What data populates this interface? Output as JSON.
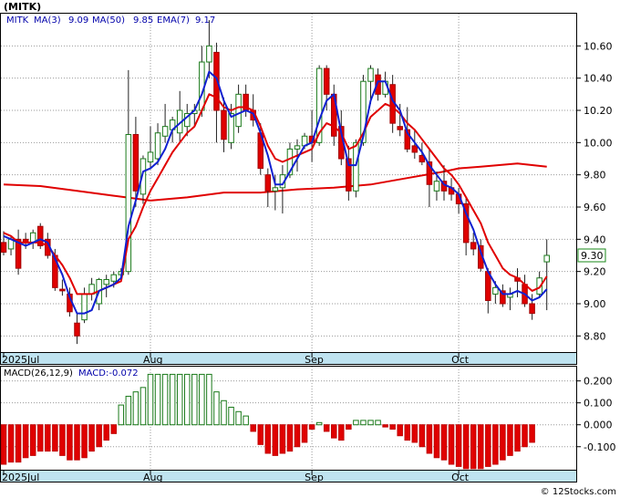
{
  "chart_data": [
    {
      "type": "candlestick",
      "ticker_label": "(MITK)",
      "legend": {
        "symbol": "MITK",
        "ma3_label": "MA(3)",
        "ma3_value": "9.09",
        "ma50_label": "MA(50)",
        "ma50_value": "9.85",
        "ema7_label": "EMA(7)",
        "ema7_value": "9.17"
      },
      "last_price_label": "9.30",
      "last_price": 9.3,
      "ylim": [
        8.7,
        10.8
      ],
      "yticks": [
        {
          "value": 8.8,
          "label": "8.80"
        },
        {
          "value": 9.0,
          "label": "9.00"
        },
        {
          "value": 9.2,
          "label": "9.20"
        },
        {
          "value": 9.4,
          "label": "9.40"
        },
        {
          "value": 9.6,
          "label": "9.60"
        },
        {
          "value": 9.8,
          "label": "9.80"
        },
        {
          "value": 10.0,
          "label": "10.00"
        },
        {
          "value": 10.2,
          "label": "10.20"
        },
        {
          "value": 10.4,
          "label": "10.40"
        },
        {
          "value": 10.6,
          "label": "10.60"
        }
      ],
      "xticks": [
        {
          "index": 0,
          "label": "2025Jul"
        },
        {
          "index": 20,
          "label": "Aug"
        },
        {
          "index": 42,
          "label": "Sep"
        },
        {
          "index": 62,
          "label": "Oct"
        }
      ],
      "candles": [
        [
          9.38,
          9.45,
          9.3,
          9.32
        ],
        [
          9.34,
          9.42,
          9.3,
          9.4
        ],
        [
          9.4,
          9.46,
          9.18,
          9.22
        ],
        [
          9.4,
          9.44,
          9.34,
          9.38
        ],
        [
          9.38,
          9.46,
          9.34,
          9.44
        ],
        [
          9.48,
          9.5,
          9.34,
          9.36
        ],
        [
          9.4,
          9.44,
          9.28,
          9.3
        ],
        [
          9.3,
          9.34,
          9.08,
          9.1
        ],
        [
          9.09,
          9.15,
          9.05,
          9.08
        ],
        [
          9.06,
          9.1,
          8.92,
          8.95
        ],
        [
          8.88,
          8.94,
          8.75,
          8.8
        ],
        [
          8.9,
          9.1,
          8.88,
          9.06
        ],
        [
          9.06,
          9.16,
          9.02,
          9.12
        ],
        [
          9.0,
          9.16,
          8.96,
          9.15
        ],
        [
          9.12,
          9.18,
          9.04,
          9.15
        ],
        [
          9.14,
          9.2,
          9.1,
          9.18
        ],
        [
          9.18,
          9.22,
          9.14,
          9.2
        ],
        [
          9.2,
          10.45,
          9.18,
          10.05
        ],
        [
          10.05,
          10.16,
          9.6,
          9.7
        ],
        [
          9.68,
          9.92,
          9.62,
          9.9
        ],
        [
          9.88,
          10.1,
          9.84,
          9.94
        ],
        [
          9.9,
          10.12,
          9.86,
          10.06
        ],
        [
          10.04,
          10.24,
          10.0,
          10.1
        ],
        [
          10.08,
          10.16,
          10.0,
          10.14
        ],
        [
          10.06,
          10.32,
          10.0,
          10.2
        ],
        [
          10.1,
          10.24,
          10.04,
          10.18
        ],
        [
          10.18,
          10.24,
          10.1,
          10.2
        ],
        [
          10.2,
          10.6,
          10.16,
          10.5
        ],
        [
          10.5,
          10.76,
          10.4,
          10.6
        ],
        [
          10.56,
          10.62,
          10.0,
          10.2
        ],
        [
          10.2,
          10.28,
          9.94,
          10.02
        ],
        [
          10.0,
          10.24,
          9.96,
          10.18
        ],
        [
          10.1,
          10.36,
          10.06,
          10.3
        ],
        [
          10.3,
          10.36,
          10.16,
          10.2
        ],
        [
          10.2,
          10.3,
          10.1,
          10.14
        ],
        [
          10.06,
          10.12,
          9.8,
          9.84
        ],
        [
          9.8,
          9.84,
          9.6,
          9.7
        ],
        [
          9.7,
          9.8,
          9.58,
          9.72
        ],
        [
          9.72,
          9.86,
          9.56,
          9.8
        ],
        [
          9.8,
          10.0,
          9.78,
          9.96
        ],
        [
          9.96,
          10.02,
          9.82,
          9.98
        ],
        [
          9.98,
          10.06,
          9.96,
          10.04
        ],
        [
          10.04,
          10.2,
          9.88,
          10.0
        ],
        [
          10.0,
          10.48,
          9.98,
          10.46
        ],
        [
          10.46,
          10.48,
          10.2,
          10.3
        ],
        [
          10.3,
          10.36,
          9.98,
          10.04
        ],
        [
          10.1,
          10.2,
          9.86,
          9.9
        ],
        [
          9.9,
          9.98,
          9.64,
          9.7
        ],
        [
          9.7,
          10.02,
          9.66,
          10.0
        ],
        [
          10.0,
          10.42,
          9.98,
          10.38
        ],
        [
          10.38,
          10.48,
          10.24,
          10.46
        ],
        [
          10.42,
          10.46,
          10.26,
          10.3
        ],
        [
          10.3,
          10.44,
          10.28,
          10.38
        ],
        [
          10.36,
          10.42,
          10.06,
          10.12
        ],
        [
          10.1,
          10.24,
          10.04,
          10.08
        ],
        [
          10.08,
          10.22,
          9.94,
          9.96
        ],
        [
          9.98,
          10.08,
          9.9,
          9.94
        ],
        [
          9.92,
          10.0,
          9.86,
          9.88
        ],
        [
          9.88,
          9.96,
          9.6,
          9.74
        ],
        [
          9.7,
          9.82,
          9.64,
          9.76
        ],
        [
          9.76,
          9.86,
          9.64,
          9.7
        ],
        [
          9.72,
          9.78,
          9.64,
          9.68
        ],
        [
          9.68,
          9.72,
          9.56,
          9.62
        ],
        [
          9.62,
          9.66,
          9.3,
          9.38
        ],
        [
          9.38,
          9.44,
          9.3,
          9.34
        ],
        [
          9.36,
          9.4,
          9.2,
          9.22
        ],
        [
          9.2,
          9.22,
          8.94,
          9.02
        ],
        [
          9.06,
          9.14,
          9.0,
          9.1
        ],
        [
          9.08,
          9.12,
          8.98,
          9.0
        ],
        [
          9.04,
          9.1,
          8.96,
          9.06
        ],
        [
          9.16,
          9.22,
          9.04,
          9.14
        ],
        [
          9.12,
          9.18,
          8.98,
          9.0
        ],
        [
          9.0,
          9.06,
          8.9,
          8.94
        ],
        [
          9.06,
          9.2,
          9.04,
          9.16
        ],
        [
          9.26,
          9.4,
          8.96,
          9.3
        ]
      ],
      "ma3": [
        [
          0,
          9.42
        ],
        [
          1,
          9.4
        ],
        [
          2,
          9.38
        ],
        [
          3,
          9.36
        ],
        [
          4,
          9.38
        ],
        [
          5,
          9.4
        ],
        [
          6,
          9.38
        ],
        [
          7,
          9.28
        ],
        [
          8,
          9.18
        ],
        [
          9,
          9.04
        ],
        [
          10,
          8.94
        ],
        [
          11,
          8.94
        ],
        [
          12,
          8.96
        ],
        [
          13,
          9.08
        ],
        [
          14,
          9.1
        ],
        [
          15,
          9.12
        ],
        [
          16,
          9.16
        ],
        [
          17,
          9.48
        ],
        [
          18,
          9.64
        ],
        [
          19,
          9.82
        ],
        [
          20,
          9.84
        ],
        [
          21,
          9.88
        ],
        [
          22,
          9.96
        ],
        [
          23,
          10.08
        ],
        [
          24,
          10.12
        ],
        [
          25,
          10.16
        ],
        [
          26,
          10.2
        ],
        [
          27,
          10.3
        ],
        [
          28,
          10.44
        ],
        [
          29,
          10.4
        ],
        [
          30,
          10.26
        ],
        [
          31,
          10.16
        ],
        [
          32,
          10.18
        ],
        [
          33,
          10.2
        ],
        [
          34,
          10.18
        ],
        [
          35,
          10.06
        ],
        [
          36,
          9.92
        ],
        [
          37,
          9.74
        ],
        [
          38,
          9.74
        ],
        [
          39,
          9.82
        ],
        [
          40,
          9.9
        ],
        [
          41,
          9.98
        ],
        [
          42,
          10.0
        ],
        [
          43,
          10.14
        ],
        [
          44,
          10.26
        ],
        [
          45,
          10.3
        ],
        [
          46,
          10.06
        ],
        [
          47,
          9.86
        ],
        [
          48,
          9.86
        ],
        [
          49,
          10.04
        ],
        [
          50,
          10.26
        ],
        [
          51,
          10.38
        ],
        [
          52,
          10.38
        ],
        [
          53,
          10.26
        ],
        [
          54,
          10.2
        ],
        [
          55,
          10.06
        ],
        [
          56,
          10.0
        ],
        [
          57,
          9.94
        ],
        [
          58,
          9.86
        ],
        [
          59,
          9.8
        ],
        [
          60,
          9.74
        ],
        [
          61,
          9.72
        ],
        [
          62,
          9.68
        ],
        [
          63,
          9.56
        ],
        [
          64,
          9.46
        ],
        [
          65,
          9.32
        ],
        [
          66,
          9.2
        ],
        [
          67,
          9.12
        ],
        [
          68,
          9.06
        ],
        [
          69,
          9.06
        ],
        [
          70,
          9.08
        ],
        [
          71,
          9.06
        ],
        [
          72,
          9.02
        ],
        [
          73,
          9.04
        ],
        [
          74,
          9.09
        ]
      ],
      "ema7": [
        [
          0,
          9.44
        ],
        [
          1,
          9.42
        ],
        [
          2,
          9.38
        ],
        [
          3,
          9.38
        ],
        [
          4,
          9.38
        ],
        [
          5,
          9.38
        ],
        [
          6,
          9.36
        ],
        [
          7,
          9.3
        ],
        [
          8,
          9.24
        ],
        [
          9,
          9.16
        ],
        [
          10,
          9.06
        ],
        [
          11,
          9.06
        ],
        [
          12,
          9.06
        ],
        [
          13,
          9.08
        ],
        [
          14,
          9.1
        ],
        [
          15,
          9.12
        ],
        [
          16,
          9.14
        ],
        [
          17,
          9.4
        ],
        [
          18,
          9.48
        ],
        [
          19,
          9.6
        ],
        [
          20,
          9.7
        ],
        [
          21,
          9.78
        ],
        [
          22,
          9.86
        ],
        [
          23,
          9.94
        ],
        [
          24,
          10.0
        ],
        [
          25,
          10.06
        ],
        [
          26,
          10.1
        ],
        [
          27,
          10.2
        ],
        [
          28,
          10.3
        ],
        [
          29,
          10.28
        ],
        [
          30,
          10.22
        ],
        [
          31,
          10.2
        ],
        [
          32,
          10.22
        ],
        [
          33,
          10.22
        ],
        [
          34,
          10.2
        ],
        [
          35,
          10.1
        ],
        [
          36,
          9.98
        ],
        [
          37,
          9.9
        ],
        [
          38,
          9.88
        ],
        [
          39,
          9.9
        ],
        [
          40,
          9.92
        ],
        [
          41,
          9.94
        ],
        [
          42,
          9.96
        ],
        [
          43,
          10.06
        ],
        [
          44,
          10.12
        ],
        [
          45,
          10.1
        ],
        [
          46,
          10.06
        ],
        [
          47,
          9.96
        ],
        [
          48,
          9.98
        ],
        [
          49,
          10.06
        ],
        [
          50,
          10.16
        ],
        [
          51,
          10.2
        ],
        [
          52,
          10.24
        ],
        [
          53,
          10.22
        ],
        [
          54,
          10.18
        ],
        [
          55,
          10.12
        ],
        [
          56,
          10.08
        ],
        [
          57,
          10.02
        ],
        [
          58,
          9.96
        ],
        [
          59,
          9.9
        ],
        [
          60,
          9.84
        ],
        [
          61,
          9.8
        ],
        [
          62,
          9.74
        ],
        [
          63,
          9.66
        ],
        [
          64,
          9.58
        ],
        [
          65,
          9.5
        ],
        [
          66,
          9.38
        ],
        [
          67,
          9.3
        ],
        [
          68,
          9.22
        ],
        [
          69,
          9.18
        ],
        [
          70,
          9.16
        ],
        [
          71,
          9.12
        ],
        [
          72,
          9.08
        ],
        [
          73,
          9.1
        ],
        [
          74,
          9.17
        ]
      ],
      "ma50": [
        [
          0,
          9.74
        ],
        [
          5,
          9.73
        ],
        [
          10,
          9.7
        ],
        [
          15,
          9.67
        ],
        [
          20,
          9.64
        ],
        [
          25,
          9.66
        ],
        [
          30,
          9.69
        ],
        [
          35,
          9.69
        ],
        [
          40,
          9.71
        ],
        [
          45,
          9.72
        ],
        [
          50,
          9.74
        ],
        [
          55,
          9.78
        ],
        [
          60,
          9.82
        ],
        [
          62,
          9.84
        ],
        [
          65,
          9.85
        ],
        [
          70,
          9.87
        ],
        [
          74,
          9.85
        ]
      ]
    },
    {
      "type": "bar",
      "title": "MACD(26,12,9)",
      "value_label": "MACD:-0.072",
      "ylim": [
        -0.205,
        0.265
      ],
      "yticks": [
        {
          "value": 0.2,
          "label": "0.200"
        },
        {
          "value": 0.1,
          "label": "0.100"
        },
        {
          "value": 0.0,
          "label": "0.000"
        },
        {
          "value": -0.1,
          "label": "-0.100"
        }
      ],
      "xticks": [
        {
          "index": 0,
          "label": "2025Jul"
        },
        {
          "index": 20,
          "label": "Aug"
        },
        {
          "index": 42,
          "label": "Sep"
        },
        {
          "index": 62,
          "label": "Oct"
        }
      ],
      "values": [
        -0.18,
        -0.17,
        -0.17,
        -0.15,
        -0.14,
        -0.12,
        -0.12,
        -0.12,
        -0.14,
        -0.16,
        -0.16,
        -0.15,
        -0.12,
        -0.1,
        -0.07,
        -0.04,
        0.09,
        0.13,
        0.15,
        0.17,
        0.23,
        0.23,
        0.23,
        0.23,
        0.23,
        0.23,
        0.23,
        0.23,
        0.23,
        0.15,
        0.11,
        0.08,
        0.06,
        0.04,
        -0.03,
        -0.09,
        -0.13,
        -0.14,
        -0.13,
        -0.12,
        -0.1,
        -0.08,
        -0.02,
        0.01,
        -0.03,
        -0.06,
        -0.07,
        -0.02,
        0.02,
        0.02,
        0.02,
        0.02,
        -0.01,
        -0.02,
        -0.05,
        -0.07,
        -0.08,
        -0.1,
        -0.13,
        -0.15,
        -0.16,
        -0.18,
        -0.19,
        -0.2,
        -0.2,
        -0.2,
        -0.19,
        -0.18,
        -0.16,
        -0.14,
        -0.12,
        -0.1,
        -0.08
      ]
    }
  ],
  "watermark": "© 12Stocks.com"
}
